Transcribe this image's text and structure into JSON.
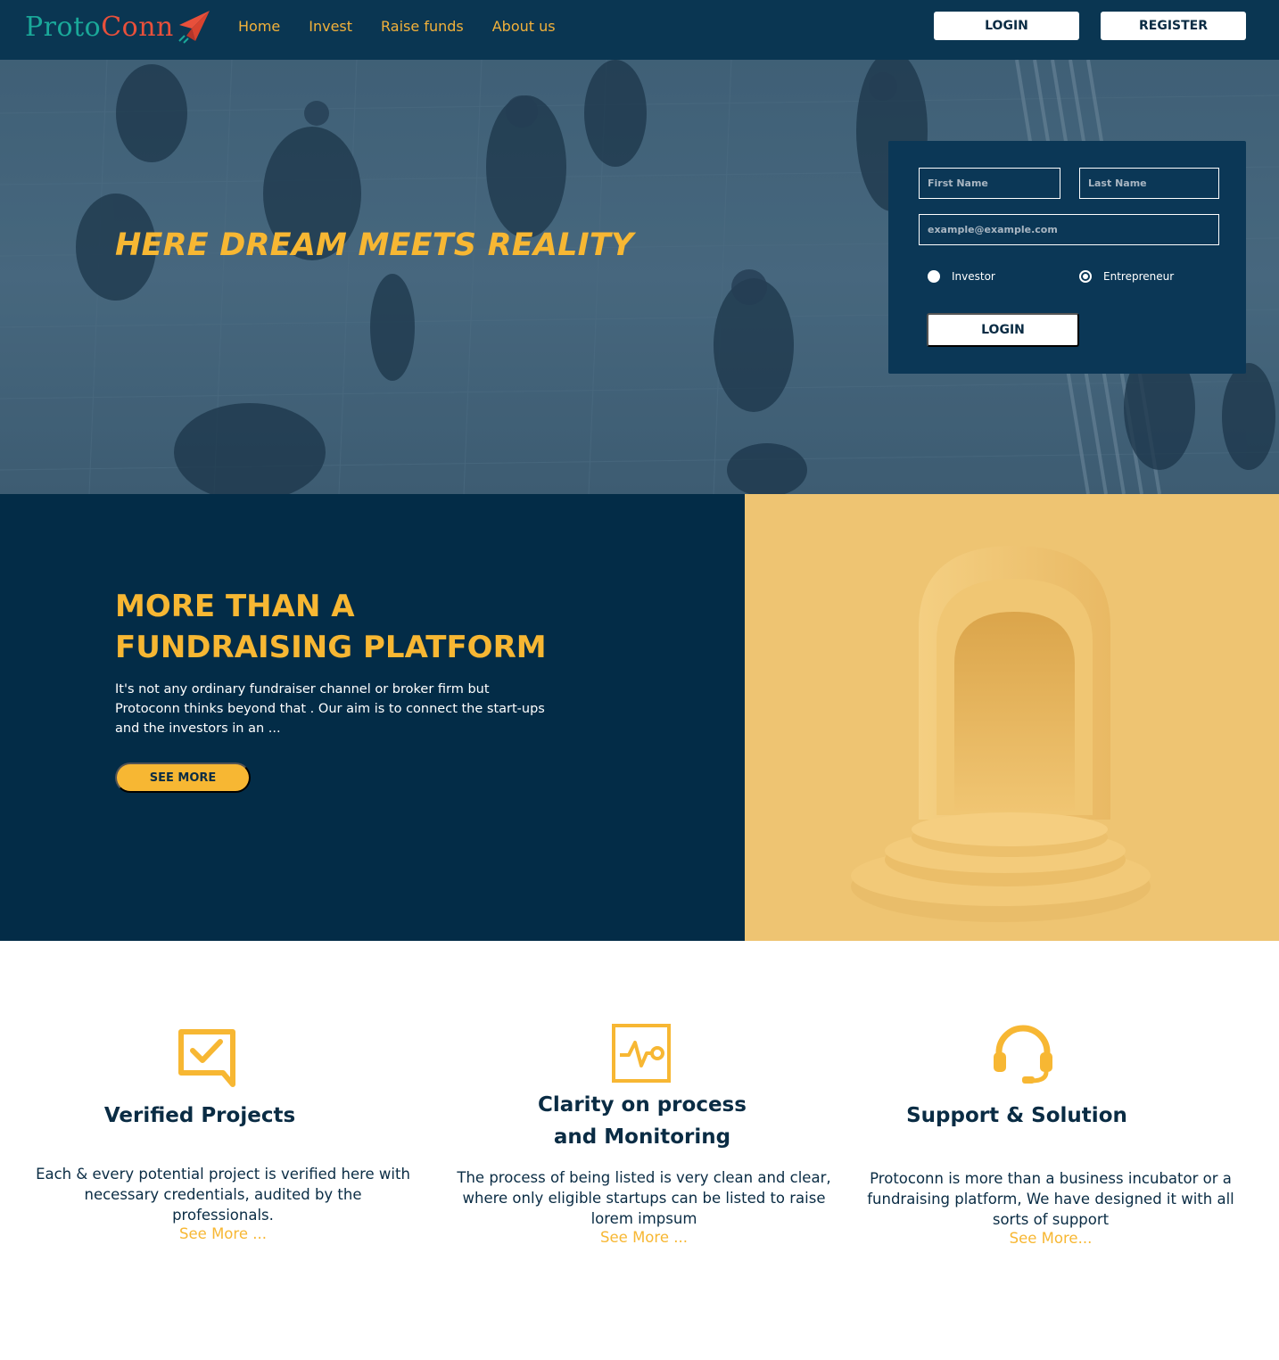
{
  "nav": {
    "logo": {
      "part1": "Proto",
      "part2": "Conn",
      "icon": "paper-plane-icon"
    },
    "links": [
      "Home",
      "Invest",
      "Raise funds",
      "About us"
    ],
    "login_label": "LOGIN",
    "register_label": "REGISTER"
  },
  "hero": {
    "title": "HERE DREAM MEETS REALITY",
    "form": {
      "first_name_placeholder": "First Name",
      "last_name_placeholder": "Last Name",
      "email_placeholder": "example@example.com",
      "role_options": [
        "Investor",
        "Entrepreneur"
      ],
      "selected_role": "Entrepreneur",
      "submit_label": "LOGIN"
    }
  },
  "about": {
    "title_line1": "MORE THAN A",
    "title_line2": "FUNDRAISING PLATFORM",
    "text": "It's not any ordinary fundraiser channel or broker firm but Protoconn thinks beyond that . Our aim is to connect the start-ups and the investors in an ...",
    "button_label": "SEE MORE"
  },
  "features": [
    {
      "icon": "verified-chat-icon",
      "title": "Verified Projects",
      "text": "Each & every potential project is verified here with necessary credentials, audited by the professionals.",
      "link": "See More ..."
    },
    {
      "icon": "pulse-monitor-icon",
      "title_line1": "Clarity on process",
      "title_line2": "and Monitoring",
      "text": "The process of being listed is very clean and clear, where only eligible startups can be listed to raise lorem impsum",
      "link": "See More ..."
    },
    {
      "icon": "headset-icon",
      "title": "Support & Solution",
      "text": "Protoconn is more than a business incubator or a fundraising platform, We have designed it with all sorts of support",
      "link": "See More..."
    }
  ],
  "colors": {
    "nav_bg": "#0a3652",
    "accent": "#f7b733",
    "dark": "#032c47",
    "sand": "#eec472"
  }
}
